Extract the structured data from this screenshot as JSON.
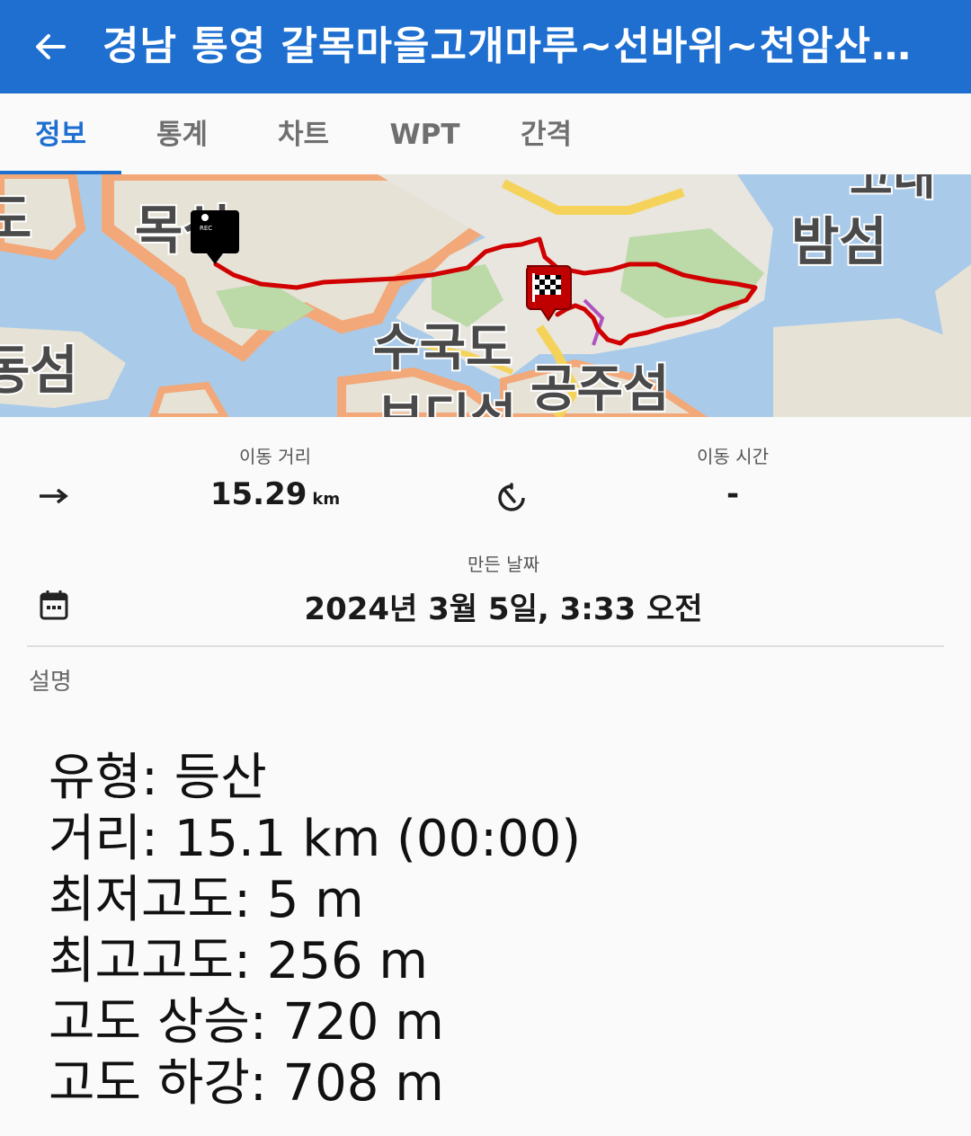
{
  "appbar": {
    "title": "경남 통영 갈목마을고개마루~선바위~천암산…"
  },
  "tabs": [
    {
      "label": "정보",
      "active": true
    },
    {
      "label": "통계"
    },
    {
      "label": "차트"
    },
    {
      "label": "WPT"
    },
    {
      "label": "간격"
    }
  ],
  "map": {
    "labels": [
      "밤섬",
      "목섬",
      "동섬",
      "수국도",
      "공주섬",
      "고내",
      "보디섬",
      "도"
    ],
    "start_marker": "REC"
  },
  "stats": {
    "distance_label": "이동 거리",
    "distance_value": "15.29",
    "distance_unit": "km",
    "time_label": "이동 시간",
    "time_value": "-",
    "created_label": "만든 날짜",
    "created_value": "2024년 3월 5일, 3:33 오전"
  },
  "description": {
    "label": "설명",
    "lines": [
      "유형: 등산",
      "거리: 15.1 km (00:00)",
      "최저고도: 5 m",
      "최고고도: 256 m",
      "고도 상승: 720 m",
      "고도 하강: 708 m"
    ]
  },
  "colors": {
    "primary": "#1e6fd0",
    "track": "#d00000",
    "water": "#a9cbe9",
    "land": "#e8e6df"
  }
}
